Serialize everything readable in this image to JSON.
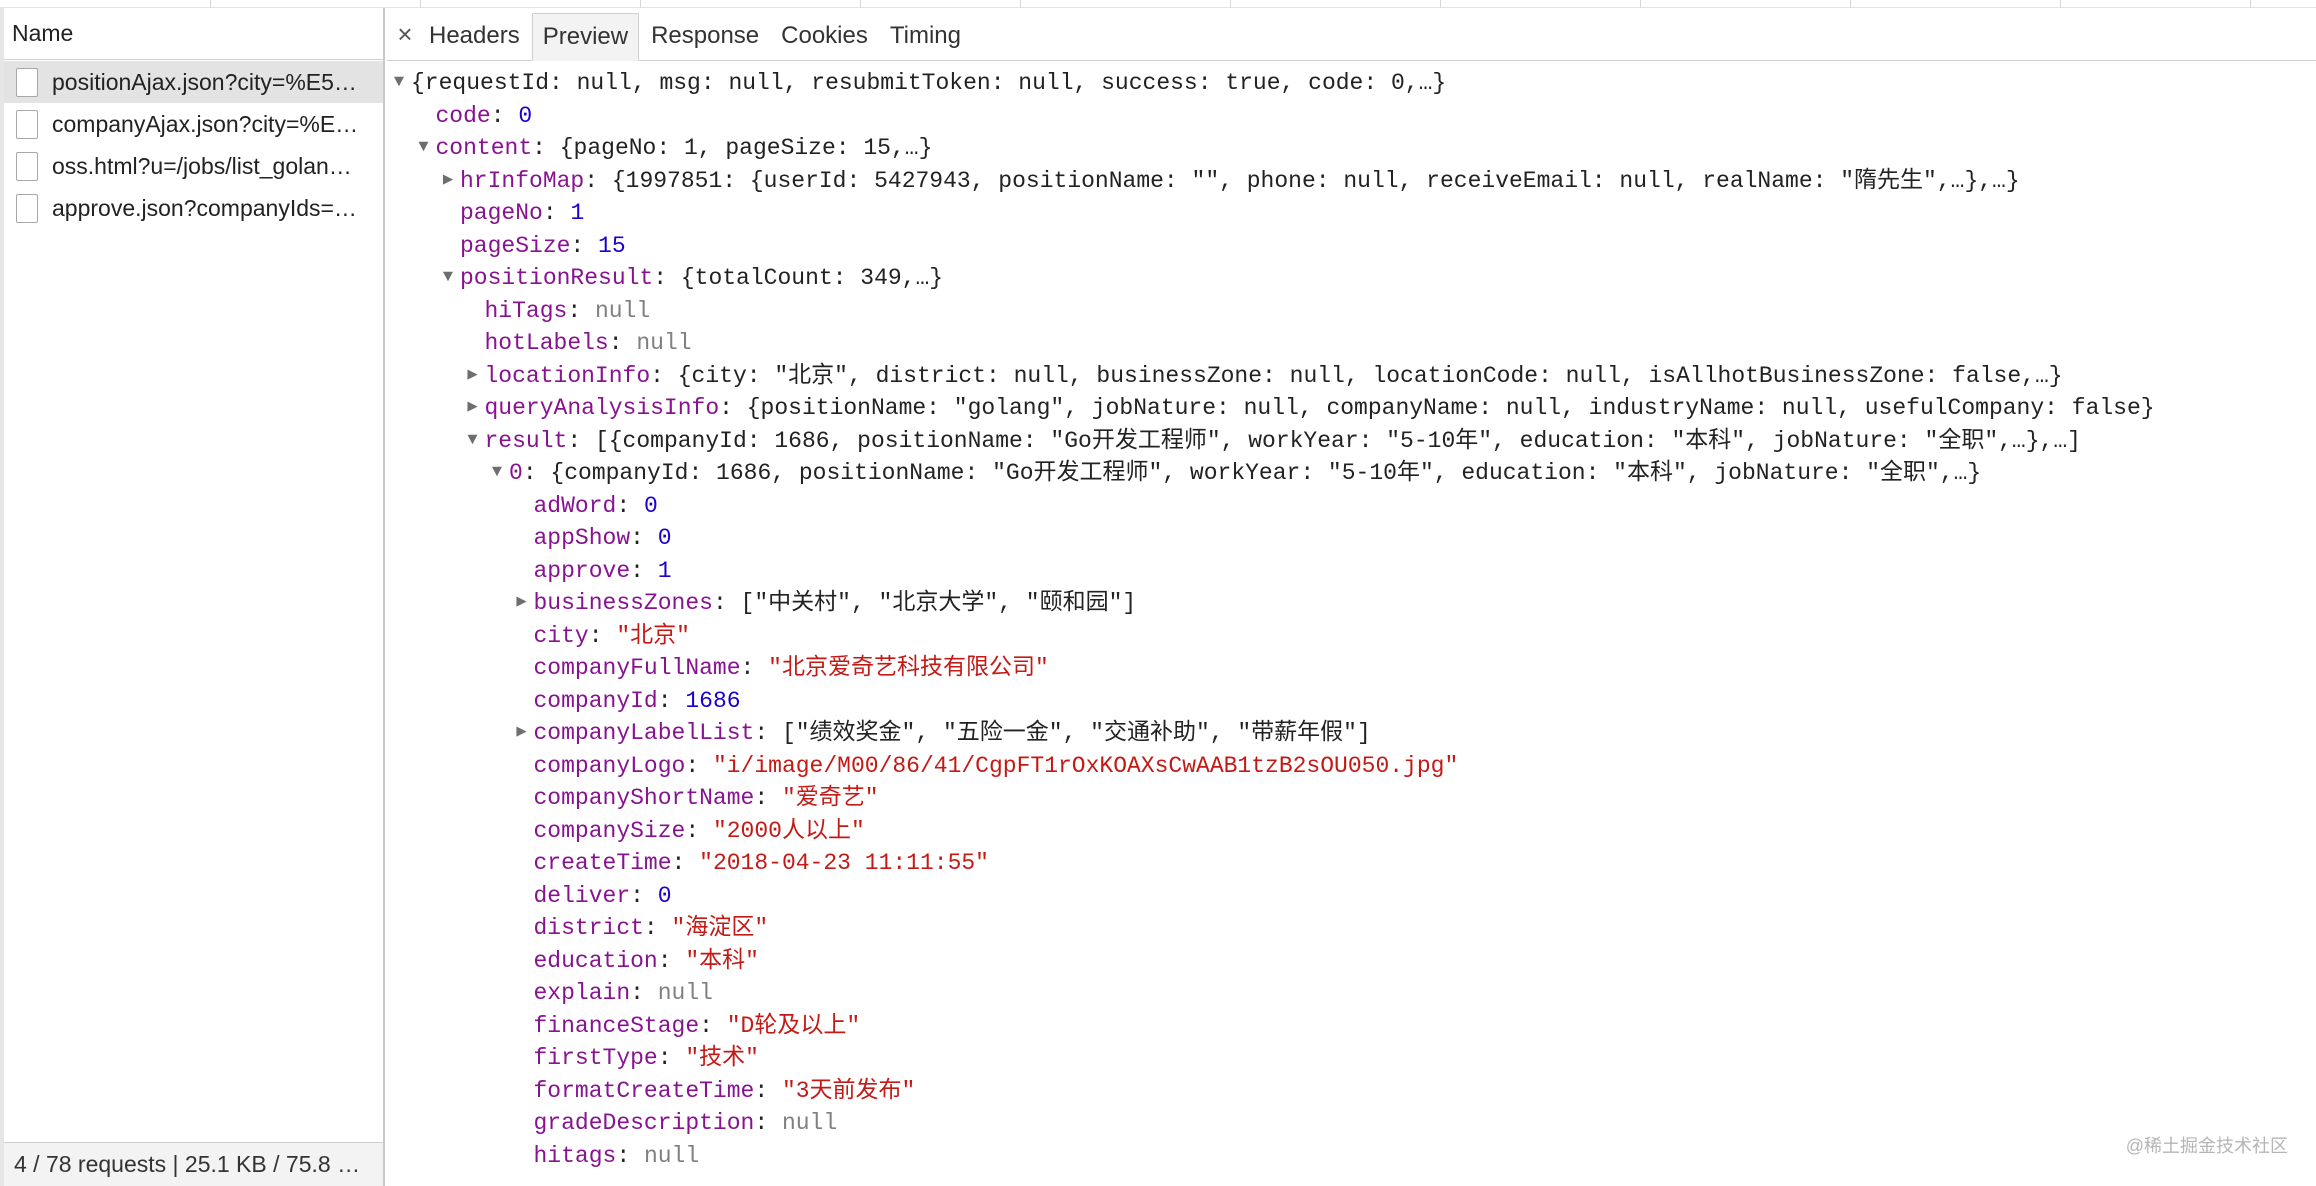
{
  "requests_panel": {
    "column_header": "Name",
    "items": [
      {
        "name": "positionAjax.json?city=%E5…",
        "selected": true
      },
      {
        "name": "companyAjax.json?city=%E…",
        "selected": false
      },
      {
        "name": "oss.html?u=/jobs/list_golan…",
        "selected": false
      },
      {
        "name": "approve.json?companyIds=…",
        "selected": false
      }
    ],
    "status": "4 / 78 requests | 25.1 KB / 75.8 …"
  },
  "detail_tabs": {
    "close": "×",
    "tabs": [
      "Headers",
      "Preview",
      "Response",
      "Cookies",
      "Timing"
    ],
    "active": "Preview"
  },
  "preview": {
    "lines": [
      {
        "indent": 0,
        "toggle": "open",
        "summary": "{requestId: null, msg: null, resubmitToken: null, success: true, code: 0,…}"
      },
      {
        "indent": 1,
        "key": "code",
        "type": "num",
        "value": "0"
      },
      {
        "indent": 1,
        "toggle": "open",
        "key": "content",
        "summary": "{pageNo: 1, pageSize: 15,…}"
      },
      {
        "indent": 2,
        "toggle": "closed",
        "key": "hrInfoMap",
        "summary": "{1997851: {userId: 5427943, positionName: \"\", phone: null, receiveEmail: null, realName: \"隋先生\",…},…}"
      },
      {
        "indent": 2,
        "key": "pageNo",
        "type": "num",
        "value": "1"
      },
      {
        "indent": 2,
        "key": "pageSize",
        "type": "num",
        "value": "15"
      },
      {
        "indent": 2,
        "toggle": "open",
        "key": "positionResult",
        "summary": "{totalCount: 349,…}"
      },
      {
        "indent": 3,
        "key": "hiTags",
        "type": "nul",
        "value": "null"
      },
      {
        "indent": 3,
        "key": "hotLabels",
        "type": "nul",
        "value": "null"
      },
      {
        "indent": 3,
        "toggle": "closed",
        "key": "locationInfo",
        "summary": "{city: \"北京\", district: null, businessZone: null, locationCode: null, isAllhotBusinessZone: false,…}"
      },
      {
        "indent": 3,
        "toggle": "closed",
        "key": "queryAnalysisInfo",
        "summary": "{positionName: \"golang\", jobNature: null, companyName: null, industryName: null, usefulCompany: false}"
      },
      {
        "indent": 3,
        "toggle": "open",
        "key": "result",
        "summary": "[{companyId: 1686, positionName: \"Go开发工程师\", workYear: \"5-10年\", education: \"本科\", jobNature: \"全职\",…},…]"
      },
      {
        "indent": 4,
        "toggle": "open",
        "key": "0",
        "summary": "{companyId: 1686, positionName: \"Go开发工程师\", workYear: \"5-10年\", education: \"本科\", jobNature: \"全职\",…}"
      },
      {
        "indent": 5,
        "key": "adWord",
        "type": "num",
        "value": "0"
      },
      {
        "indent": 5,
        "key": "appShow",
        "type": "num",
        "value": "0"
      },
      {
        "indent": 5,
        "key": "approve",
        "type": "num",
        "value": "1"
      },
      {
        "indent": 5,
        "toggle": "closed",
        "key": "businessZones",
        "summary": "[\"中关村\", \"北京大学\", \"颐和园\"]"
      },
      {
        "indent": 5,
        "key": "city",
        "type": "str",
        "value": "\"北京\""
      },
      {
        "indent": 5,
        "key": "companyFullName",
        "type": "str",
        "value": "\"北京爱奇艺科技有限公司\""
      },
      {
        "indent": 5,
        "key": "companyId",
        "type": "num",
        "value": "1686"
      },
      {
        "indent": 5,
        "toggle": "closed",
        "key": "companyLabelList",
        "summary": "[\"绩效奖金\", \"五险一金\", \"交通补助\", \"带薪年假\"]"
      },
      {
        "indent": 5,
        "key": "companyLogo",
        "type": "str",
        "value": "\"i/image/M00/86/41/CgpFT1rOxKOAXsCwAAB1tzB2sOU050.jpg\""
      },
      {
        "indent": 5,
        "key": "companyShortName",
        "type": "str",
        "value": "\"爱奇艺\""
      },
      {
        "indent": 5,
        "key": "companySize",
        "type": "str",
        "value": "\"2000人以上\""
      },
      {
        "indent": 5,
        "key": "createTime",
        "type": "str",
        "value": "\"2018-04-23 11:11:55\""
      },
      {
        "indent": 5,
        "key": "deliver",
        "type": "num",
        "value": "0"
      },
      {
        "indent": 5,
        "key": "district",
        "type": "str",
        "value": "\"海淀区\""
      },
      {
        "indent": 5,
        "key": "education",
        "type": "str",
        "value": "\"本科\""
      },
      {
        "indent": 5,
        "key": "explain",
        "type": "nul",
        "value": "null"
      },
      {
        "indent": 5,
        "key": "financeStage",
        "type": "str",
        "value": "\"D轮及以上\""
      },
      {
        "indent": 5,
        "key": "firstType",
        "type": "str",
        "value": "\"技术\""
      },
      {
        "indent": 5,
        "key": "formatCreateTime",
        "type": "str",
        "value": "\"3天前发布\""
      },
      {
        "indent": 5,
        "key": "gradeDescription",
        "type": "nul",
        "value": "null"
      },
      {
        "indent": 5,
        "key": "hitags",
        "type": "nul",
        "value": "null"
      }
    ]
  },
  "watermark": "@稀土掘金技术社区"
}
